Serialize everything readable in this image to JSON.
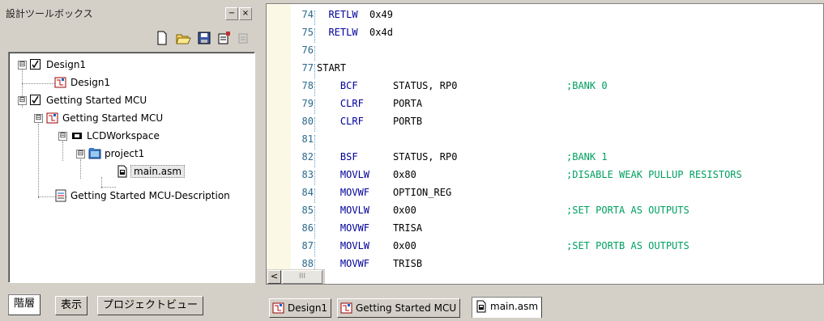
{
  "panel": {
    "title": "設計ツールボックス",
    "minimize_label": "−",
    "close_label": "×",
    "toolbar_icons": [
      "new-file-icon",
      "open-folder-icon",
      "save-icon",
      "properties-icon",
      "disabled-icon"
    ]
  },
  "tree": {
    "items": [
      {
        "label": "Design1",
        "icon": "checkbox-icon",
        "expander": "⊟"
      },
      {
        "label": "Design1",
        "icon": "design-icon"
      },
      {
        "label": "Getting Started MCU",
        "icon": "checkbox-icon",
        "expander": "⊟"
      },
      {
        "label": "Getting Started MCU",
        "icon": "design-icon",
        "expander": "⊟"
      },
      {
        "label": "LCDWorkspace",
        "icon": "workspace-icon",
        "expander": "⊟"
      },
      {
        "label": "project1",
        "icon": "project-icon",
        "expander": "⊟"
      },
      {
        "label": "main.asm",
        "icon": "asm-file-icon"
      },
      {
        "label": "Getting Started MCU-Description",
        "icon": "document-icon"
      }
    ]
  },
  "bottom_tabs": [
    "階層",
    "表示",
    "プロジェクトビュー"
  ],
  "editor": {
    "lines": [
      {
        "n": "74",
        "code": "  RETLW  0x49",
        "comment": ""
      },
      {
        "n": "75",
        "code": "  RETLW  0x4d",
        "comment": ""
      },
      {
        "n": "76",
        "code": "",
        "comment": ""
      },
      {
        "n": "77",
        "code": "START",
        "comment": ""
      },
      {
        "n": "78",
        "code": "    BCF      STATUS, RP0",
        "comment": ";BANK 0"
      },
      {
        "n": "79",
        "code": "    CLRF     PORTA",
        "comment": ""
      },
      {
        "n": "80",
        "code": "    CLRF     PORTB",
        "comment": ""
      },
      {
        "n": "81",
        "code": "",
        "comment": ""
      },
      {
        "n": "82",
        "code": "    BSF      STATUS, RP0",
        "comment": ";BANK 1"
      },
      {
        "n": "83",
        "code": "    MOVLW    0x80",
        "comment": ";DISABLE WEAK PULLUP RESISTORS"
      },
      {
        "n": "84",
        "code": "    MOVWF    OPTION_REG",
        "comment": ""
      },
      {
        "n": "85",
        "code": "    MOVLW    0x00",
        "comment": ";SET PORTA AS OUTPUTS"
      },
      {
        "n": "86",
        "code": "    MOVWF    TRISA",
        "comment": ""
      },
      {
        "n": "87",
        "code": "    MOVLW    0x00",
        "comment": ";SET PORTB AS OUTPUTS"
      },
      {
        "n": "88",
        "code": "    MOVWF    TRISB",
        "comment": ""
      }
    ],
    "scroll_left_label": "<",
    "scroll_thumb_label": "III"
  },
  "editor_tabs": [
    "Design1",
    "Getting Started MCU",
    "main.asm"
  ],
  "colors": {
    "keyword": "#00009a",
    "comment": "#00a060",
    "line_number": "#2a6a8a",
    "gutter": "#fbf9e6",
    "chrome": "#d4d0c8"
  }
}
